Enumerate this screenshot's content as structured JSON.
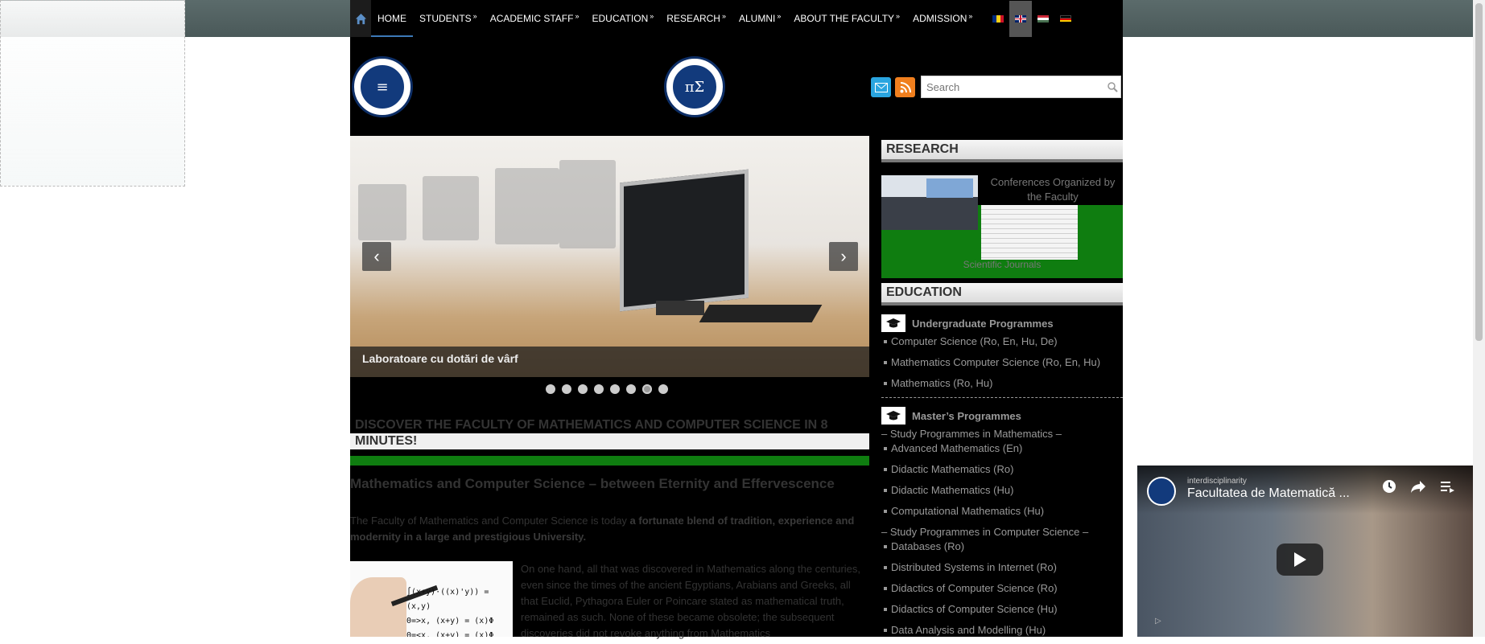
{
  "nav": {
    "items": [
      {
        "label": "HOME",
        "has_submenu": false
      },
      {
        "label": "STUDENTS",
        "has_submenu": true
      },
      {
        "label": "ACADEMIC STAFF",
        "has_submenu": true
      },
      {
        "label": "EDUCATION",
        "has_submenu": true
      },
      {
        "label": "RESEARCH",
        "has_submenu": true
      },
      {
        "label": "ALUMNI",
        "has_submenu": true
      },
      {
        "label": "ABOUT THE FACULTY",
        "has_submenu": true
      },
      {
        "label": "ADMISSION",
        "has_submenu": true
      }
    ],
    "submenu_marker": "»",
    "languages": [
      "ro",
      "en",
      "hu",
      "de"
    ],
    "active_language": "en"
  },
  "header": {
    "search_placeholder": "Search",
    "logo_left_glyph": "≡",
    "logo_center_glyph": "πΣ"
  },
  "slider": {
    "caption": "Laboratoare cu dotări de vârf",
    "prev": "‹",
    "next": "›",
    "slide_count": 8,
    "active_slide": 7
  },
  "main": {
    "discover_title_line1": "DISCOVER THE FACULTY OF MATHEMATICS AND COMPUTER SCIENCE IN 8",
    "discover_title_line2": "MINUTES!",
    "article_title": "Mathematics and Computer Science – between Eternity and Effervescence",
    "p1_plain": "The Faculty of Mathematics and Computer Science is today ",
    "p1_bold": "a fortunate blend of tradition, experience and modernity in a large and prestigious University.",
    "p2": "On one hand, all that was discovered in Mathematics along the centuries, even since the times of the ancient Egyptians, Arabians and Greeks, all that Euclid, Pythagora Euler or Poincare stated as mathematical truth, remained as such. None of these became obsolete; the subsequent discoveries did not revoke anything from Mathematics"
  },
  "sidebar": {
    "research_heading": "RESEARCH",
    "research_items": [
      "Conferences Organized by the Faculty",
      "Scientific Journals"
    ],
    "education_heading": "EDUCATION",
    "undergrad_label": "Undergraduate Programmes",
    "undergrad": [
      "Computer Science (Ro, En, Hu, De)",
      "Mathematics Computer Science (Ro, En, Hu)",
      "Mathematics (Ro, Hu)"
    ],
    "masters_label": "Master’s Programmes",
    "masters_math_heading": "– Study Programmes in Mathematics –",
    "masters_math": [
      "Advanced Mathematics (En)",
      "Didactic Mathematics (Ro)",
      "Didactic Mathematics (Hu)",
      "Computational Mathematics (Hu)"
    ],
    "masters_cs_heading": "– Study Programmes in Computer Science –",
    "masters_cs": [
      "Databases (Ro)",
      "Distributed Systems in Internet (Ro)",
      "Didactics of Computer Science (Ro)",
      "Didactics of Computer Science (Hu)",
      "Data Analysis and Modelling (Hu)"
    ]
  },
  "video": {
    "channel": "interdisciplinarity",
    "title": "Facultatea de Matematică ..."
  },
  "colors": {
    "accent_green": "#0f7d10",
    "topbar": "#4f5e5e",
    "site_bg": "#000000"
  }
}
